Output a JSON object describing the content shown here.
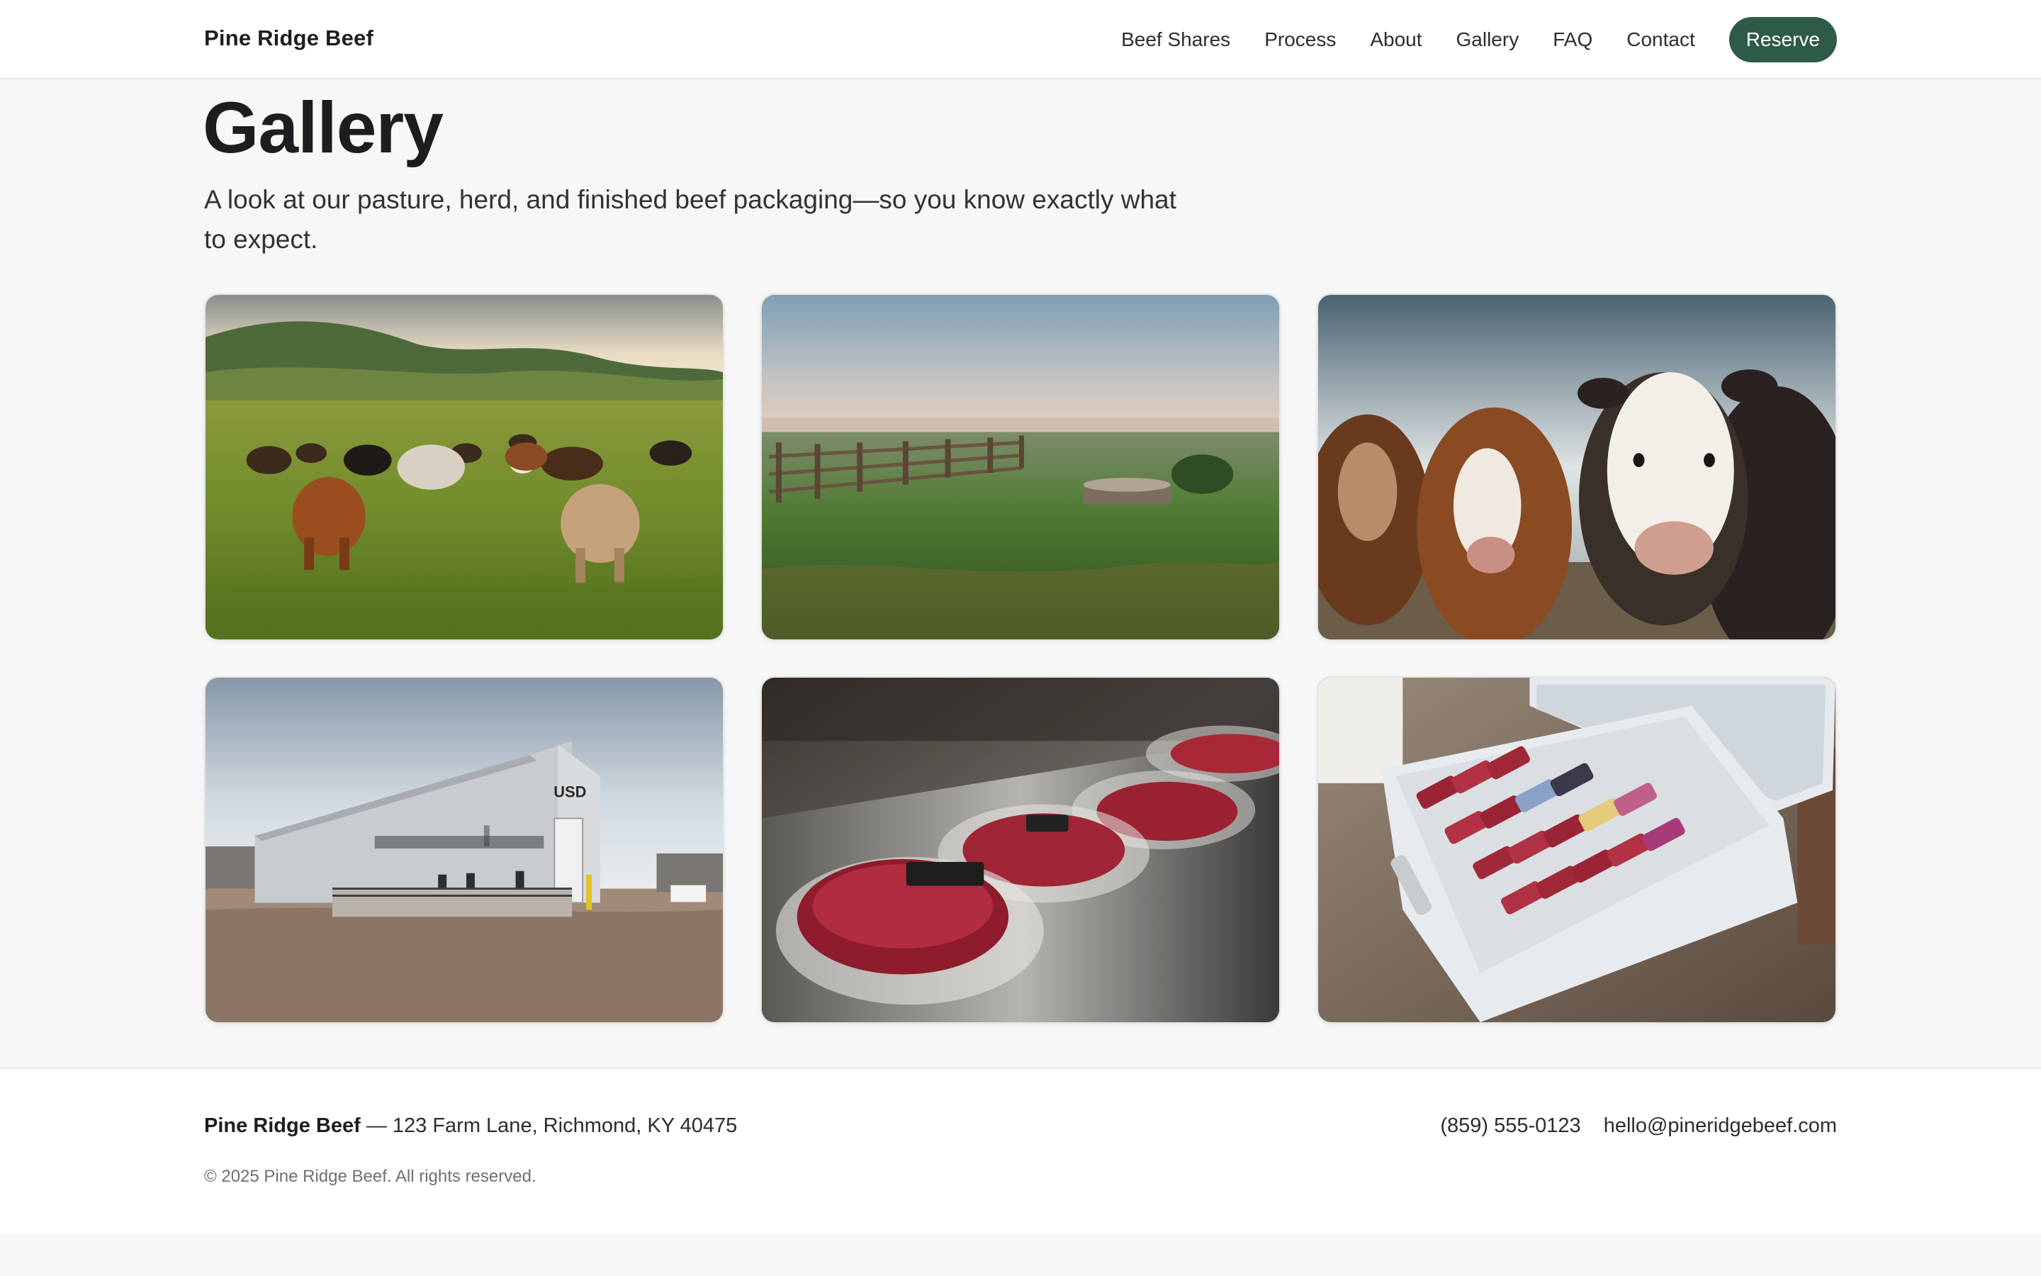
{
  "header": {
    "brand": "Pine Ridge Beef",
    "nav": [
      "Beef Shares",
      "Process",
      "About",
      "Gallery",
      "FAQ",
      "Contact"
    ],
    "cta": "Reserve"
  },
  "main": {
    "title": "Gallery",
    "subtitle": "A look at our pasture, herd, and finished beef packaging—so you know exactly what to expect.",
    "gallery": [
      {
        "name": "cattle-grazing-pasture-photo"
      },
      {
        "name": "misty-pasture-fence-photo"
      },
      {
        "name": "cattle-closeup-photo"
      },
      {
        "name": "processing-facility-photo",
        "sign": "USD"
      },
      {
        "name": "vacuum-sealed-steaks-photo"
      },
      {
        "name": "chest-freezer-beef-photo"
      }
    ]
  },
  "footer": {
    "brand": "Pine Ridge Beef",
    "address": " — 123 Farm Lane, Richmond, KY 40475",
    "copyright": "© 2025 Pine Ridge Beef. All rights reserved.",
    "phone": "(859) 555-0123",
    "email": "hello@pineridgebeef.com"
  },
  "colors": {
    "accent": "#2d5b46",
    "page_background": "#f6f7f6",
    "surface": "#ffffff",
    "text": "#1f2326"
  }
}
